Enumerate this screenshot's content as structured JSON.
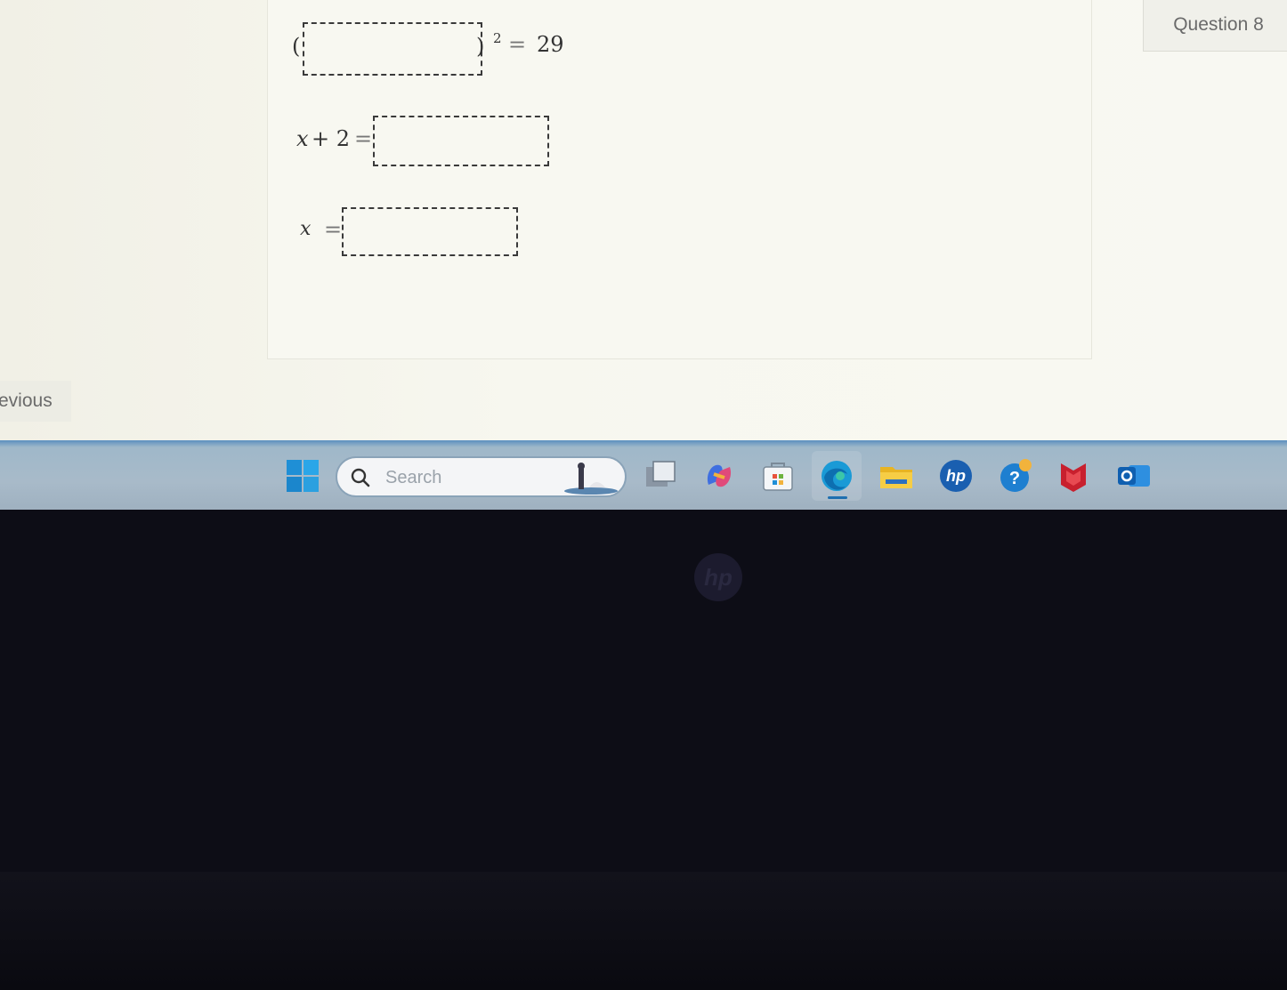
{
  "question": {
    "tab_label": "Question 8",
    "lines": [
      {
        "left_open": "(",
        "right_close": ")",
        "exponent": "2",
        "equals": "=",
        "rhs": "29"
      },
      {
        "lhs_var": "x",
        "lhs_rest": "+ 2",
        "equals": "="
      },
      {
        "lhs_var": "x",
        "equals": "="
      }
    ]
  },
  "nav": {
    "previous_label": "evious"
  },
  "taskbar": {
    "search_placeholder": "Search",
    "icons": [
      "windows-start-icon",
      "task-view-icon",
      "copilot-icon",
      "store-icon",
      "edge-icon",
      "file-explorer-icon",
      "hp-icon",
      "help-icon",
      "mcafee-icon",
      "outlook-icon"
    ]
  },
  "bezel": {
    "logo_text": "hp"
  },
  "colors": {
    "taskbar": "#a8bac9",
    "page_bg": "#f8f8f1",
    "bezel": "#0d0d16"
  }
}
